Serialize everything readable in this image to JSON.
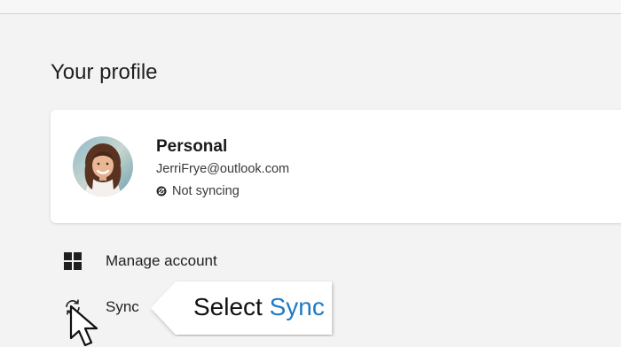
{
  "page": {
    "title": "Your profile"
  },
  "profile": {
    "name": "Personal",
    "email": "JerriFrye@outlook.com",
    "sync_status": "Not syncing"
  },
  "menu": {
    "items": [
      {
        "label": "Manage account",
        "icon": "windows-grid-icon"
      },
      {
        "label": "Sync",
        "icon": "sync-icon"
      }
    ]
  },
  "callout": {
    "prefix": "Select",
    "highlight": "Sync"
  },
  "colors": {
    "accent": "#1f7ac4",
    "background": "#f3f3f3",
    "card": "#ffffff"
  }
}
